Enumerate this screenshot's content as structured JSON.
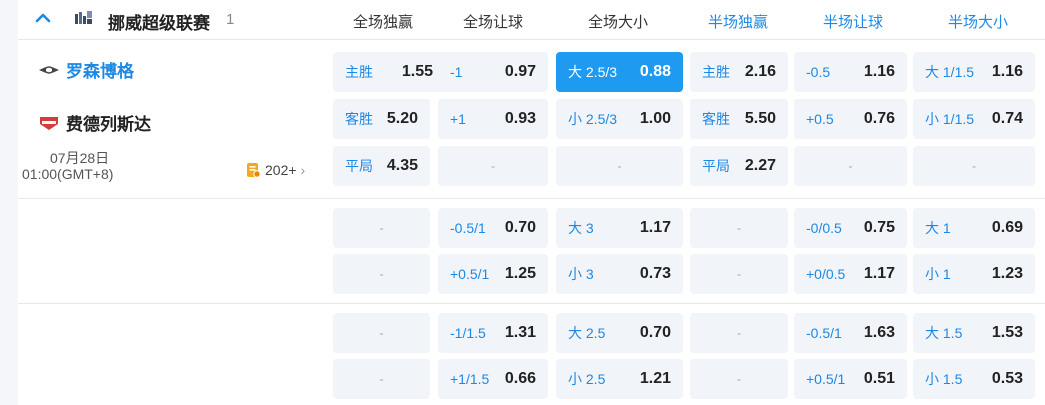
{
  "league": {
    "name": "挪威超级联赛",
    "count": "1",
    "icon": "flag-icon"
  },
  "columns": {
    "full_win": "全场独赢",
    "full_handicap": "全场让球",
    "full_ou": "全场大小",
    "half_win": "半场独赢",
    "half_handicap": "半场让球",
    "half_ou": "半场大小"
  },
  "match": {
    "home": "罗森博格",
    "away": "费德列斯达",
    "date": "07月28日",
    "time": "01:00(GMT+8)",
    "more": "202+"
  },
  "odds": {
    "r0": {
      "fw1": {
        "label": "主胜",
        "value": "1.55"
      },
      "fh1": {
        "label": "-1",
        "value": "0.97"
      },
      "fo1": {
        "label": "大 2.5/3",
        "value": "0.88"
      },
      "hw1": {
        "label": "主胜",
        "value": "2.16"
      },
      "hh1": {
        "label": "-0.5",
        "value": "1.16"
      },
      "ho1": {
        "label": "大 1/1.5",
        "value": "1.16"
      },
      "fw2": {
        "label": "客胜",
        "value": "5.20"
      },
      "fh2": {
        "label": "+1",
        "value": "0.93"
      },
      "fo2": {
        "label": "小 2.5/3",
        "value": "1.00"
      },
      "hw2": {
        "label": "客胜",
        "value": "5.50"
      },
      "hh2": {
        "label": "+0.5",
        "value": "0.76"
      },
      "ho2": {
        "label": "小 1/1.5",
        "value": "0.74"
      },
      "fw3": {
        "label": "平局",
        "value": "4.35"
      },
      "hw3": {
        "label": "平局",
        "value": "2.27"
      }
    },
    "r1": {
      "fh1": {
        "label": "-0.5/1",
        "value": "0.70"
      },
      "fo1": {
        "label": "大 3",
        "value": "1.17"
      },
      "hh1": {
        "label": "-0/0.5",
        "value": "0.75"
      },
      "ho1": {
        "label": "大 1",
        "value": "0.69"
      },
      "fh2": {
        "label": "+0.5/1",
        "value": "1.25"
      },
      "fo2": {
        "label": "小 3",
        "value": "0.73"
      },
      "hh2": {
        "label": "+0/0.5",
        "value": "1.17"
      },
      "ho2": {
        "label": "小 1",
        "value": "1.23"
      }
    },
    "r2": {
      "fh1": {
        "label": "-1/1.5",
        "value": "1.31"
      },
      "fo1": {
        "label": "大 2.5",
        "value": "0.70"
      },
      "hh1": {
        "label": "-0.5/1",
        "value": "1.63"
      },
      "ho1": {
        "label": "大 1.5",
        "value": "1.53"
      },
      "fh2": {
        "label": "+1/1.5",
        "value": "0.66"
      },
      "fo2": {
        "label": "小 2.5",
        "value": "1.21"
      },
      "hh2": {
        "label": "+0.5/1",
        "value": "0.51"
      },
      "ho2": {
        "label": "小 1.5",
        "value": "0.53"
      }
    }
  },
  "empty_mark": "-",
  "colors": {
    "accent": "#1e88e5",
    "active_cell": "#1e9bf0",
    "cell_bg": "#f1f4f8"
  }
}
